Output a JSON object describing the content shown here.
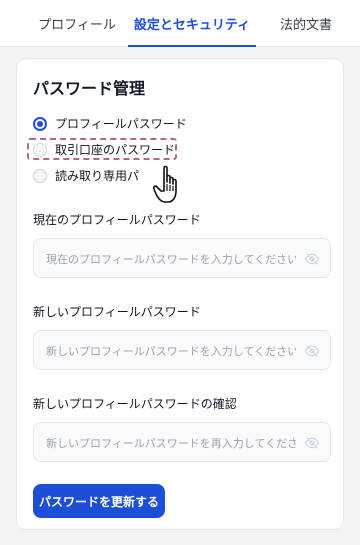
{
  "tabs": [
    {
      "label": "プロフィール",
      "active": false
    },
    {
      "label": "設定とセキュリティ",
      "active": true
    },
    {
      "label": "法的文書",
      "active": false
    }
  ],
  "password_management": {
    "title": "パスワード管理",
    "options": [
      {
        "label": "プロフィールパスワード",
        "selected": true
      },
      {
        "label": "取引口座のパスワード",
        "selected": false
      },
      {
        "label": "読み取り専用パ",
        "selected": false
      }
    ]
  },
  "fields": {
    "current": {
      "label": "現在のプロフィールパスワード",
      "placeholder": "現在のプロフィールパスワードを入力してください",
      "value": ""
    },
    "new": {
      "label": "新しいプロフィールパスワード",
      "placeholder": "新しいプロフィールパスワードを入力してください",
      "value": ""
    },
    "confirm": {
      "label": "新しいプロフィールパスワードの確認",
      "placeholder": "新しいプロフィールパスワードを再入力してください",
      "value": ""
    }
  },
  "actions": {
    "update_label": "パスワードを更新する"
  },
  "colors": {
    "accent": "#1d4ed8",
    "highlight": "#b06a7b",
    "background": "#f3f4f6"
  },
  "icons": {
    "eye_toggle": "eye-off-icon",
    "cursor": "hand-pointer-icon"
  }
}
